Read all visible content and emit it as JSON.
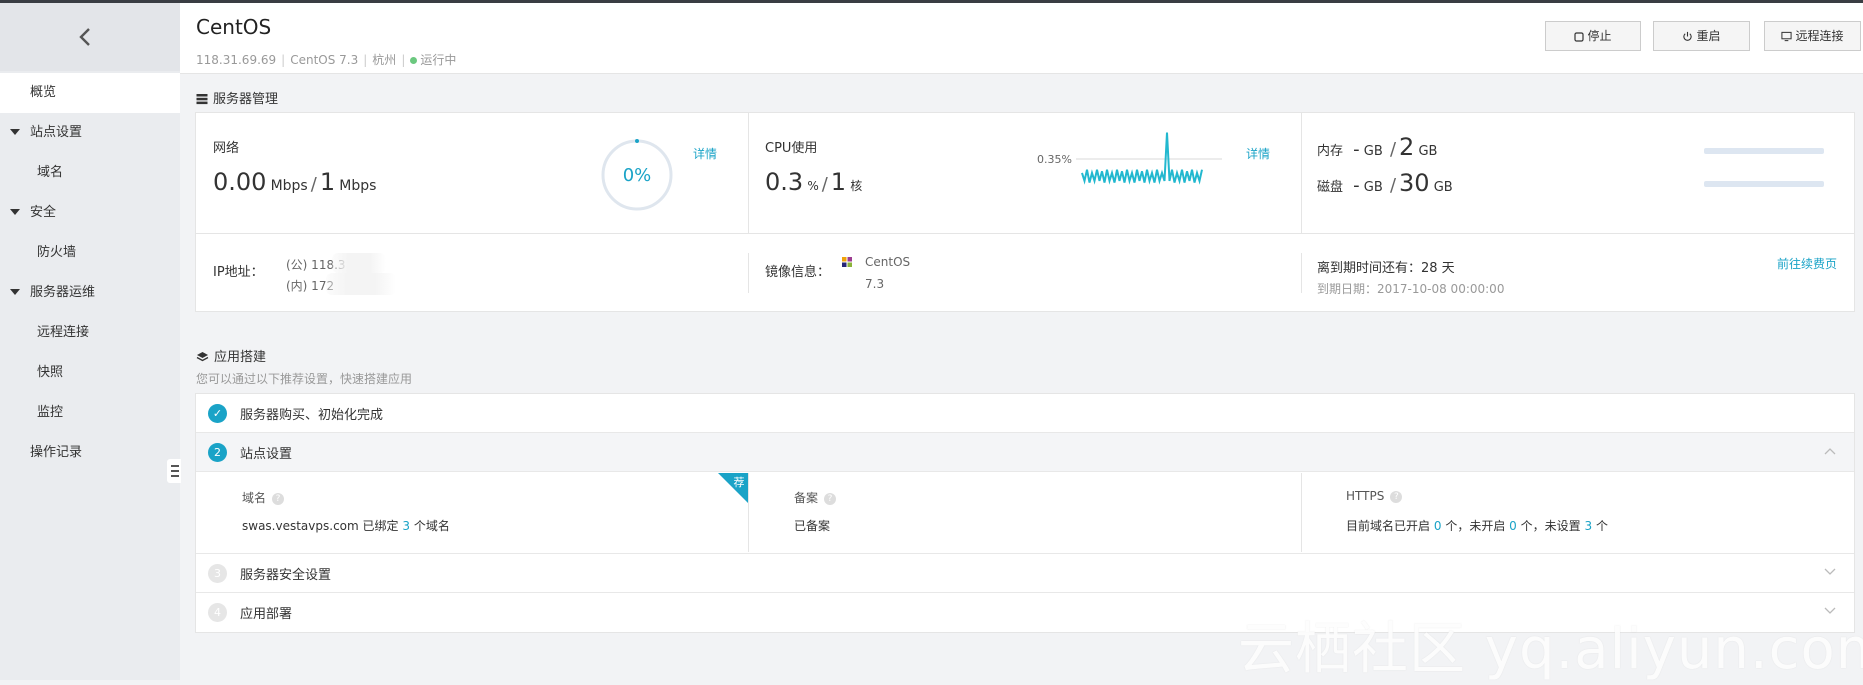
{
  "header": {
    "title": "CentOS",
    "ip": "118.31.69.69",
    "os": "CentOS 7.3",
    "region": "杭州",
    "status": "运行中",
    "buttons": {
      "stop": "停止",
      "restart": "重启",
      "remote": "远程连接"
    }
  },
  "sidebar": {
    "items": [
      {
        "label": "概览"
      },
      {
        "label": "站点设置"
      },
      {
        "label": "域名"
      },
      {
        "label": "安全"
      },
      {
        "label": "防火墙"
      },
      {
        "label": "服务器运维"
      },
      {
        "label": "远程连接"
      },
      {
        "label": "快照"
      },
      {
        "label": "监控"
      },
      {
        "label": "操作记录"
      }
    ]
  },
  "server": {
    "section_title": "服务器管理",
    "network": {
      "label": "网络",
      "value": "0.00",
      "unit": "Mbps",
      "sep": "/",
      "max": "1",
      "max_unit": "Mbps",
      "gauge_text": "0%",
      "detail": "详情"
    },
    "cpu": {
      "label": "CPU使用",
      "value": "0.3",
      "unit": "%",
      "sep": "/",
      "cores": "1",
      "cores_unit": "核",
      "peak_label": "0.35%",
      "detail": "详情",
      "sparkline": [
        0.1,
        0.05,
        0.12,
        0.04,
        0.1,
        0.05,
        0.12,
        0.05,
        0.11,
        0.04,
        0.12,
        0.05,
        0.1,
        0.04,
        0.12,
        0.05,
        0.11,
        0.04,
        0.12,
        0.05,
        0.1,
        0.04,
        0.12,
        0.05,
        0.11,
        0.04,
        0.12,
        0.05,
        0.1,
        0.04,
        0.12,
        0.05,
        0.1,
        0.05,
        0.35,
        0.05,
        0.12,
        0.04,
        0.1,
        0.05,
        0.12,
        0.04,
        0.11,
        0.05,
        0.12,
        0.04,
        0.1,
        0.05,
        0.12
      ]
    },
    "memory": {
      "label": "内存",
      "used": "-",
      "used_unit": "GB",
      "sep": "/",
      "total": "2",
      "total_unit": "GB"
    },
    "disk": {
      "label": "磁盘",
      "used": "-",
      "used_unit": "GB",
      "sep": "/",
      "total": "30",
      "total_unit": "GB"
    },
    "ip": {
      "label": "IP地址：",
      "public": "(公) 118.3",
      "private": "(内) 172"
    },
    "image": {
      "label": "镜像信息：",
      "name": "CentOS",
      "version": "7.3"
    },
    "expiry": {
      "remaining": "离到期时间还有：28 天",
      "date": "到期日期：2017-10-08 00:00:00",
      "renew": "前往续费页"
    }
  },
  "apps": {
    "section_title": "应用搭建",
    "subtitle": "您可以通过以下推荐设置，快速搭建应用",
    "steps": [
      {
        "num": "✓",
        "label": "服务器购买、初始化完成"
      },
      {
        "num": "2",
        "label": "站点设置"
      },
      {
        "num": "3",
        "label": "服务器安全设置"
      },
      {
        "num": "4",
        "label": "应用部署"
      }
    ],
    "site": {
      "badge": "荐",
      "domain_label": "域名",
      "domain_text_pre": "swas.vestavps.com 已绑定",
      "domain_count": "3",
      "domain_text_post": "个域名",
      "icp_label": "备案",
      "icp_value": "已备案",
      "https_label": "HTTPS",
      "https_pre": "目前域名已开启",
      "https_on": "0",
      "https_mid1": "个，未开启",
      "https_off": "0",
      "https_mid2": "个，未设置",
      "https_unset": "3",
      "https_post": "个"
    }
  },
  "watermark": "云栖社区 yq.aliyun.com",
  "colors": {
    "accent": "#1aa3c7",
    "status": "#6bc87f",
    "sidebar": "#eaecef"
  }
}
